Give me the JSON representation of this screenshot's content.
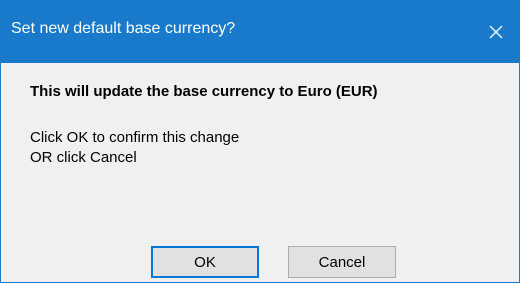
{
  "window": {
    "title": "Set new default base currency?",
    "close_glyph": "close-icon"
  },
  "message": {
    "headline": "This will update the base currency to Euro (EUR)",
    "line1": "Click OK to confirm this change",
    "line2": "OR click Cancel"
  },
  "buttons": {
    "ok_label": "OK",
    "cancel_label": "Cancel"
  },
  "colors": {
    "titlebar": "#1979ca",
    "dialog_bg": "#f0f0f0",
    "default_button_border": "#0078d7"
  }
}
